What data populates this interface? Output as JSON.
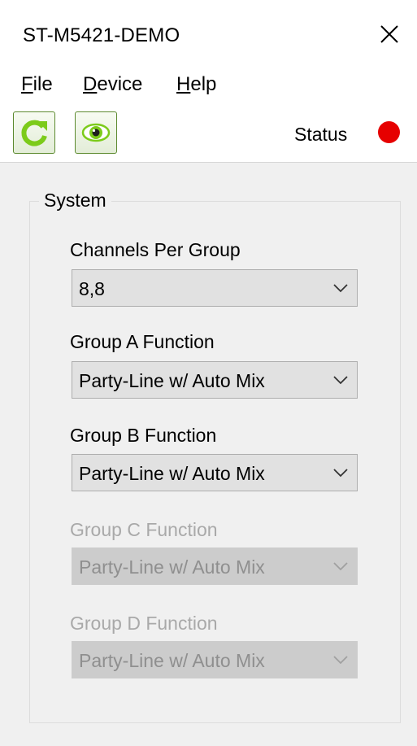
{
  "window": {
    "title": "ST-M5421-DEMO"
  },
  "menu": {
    "file": {
      "accel": "F",
      "rest": "ile"
    },
    "device": {
      "accel": "D",
      "rest": "evice"
    },
    "help": {
      "accel": "H",
      "rest": "elp"
    }
  },
  "toolbar": {
    "refresh_icon": "refresh-icon",
    "view_icon": "eye-icon",
    "status_label": "Status",
    "status_color": "#e60000",
    "accent_color": "#7ccb1a"
  },
  "system": {
    "legend": "System",
    "channels_per_group": {
      "label": "Channels Per Group",
      "value": "8,8",
      "enabled": true
    },
    "group_a": {
      "label": "Group A Function",
      "value": "Party-Line w/ Auto Mix",
      "enabled": true
    },
    "group_b": {
      "label": "Group B Function",
      "value": "Party-Line w/ Auto Mix",
      "enabled": true
    },
    "group_c": {
      "label": "Group C Function",
      "value": "Party-Line w/ Auto Mix",
      "enabled": false
    },
    "group_d": {
      "label": "Group D Function",
      "value": "Party-Line w/ Auto Mix",
      "enabled": false
    }
  }
}
